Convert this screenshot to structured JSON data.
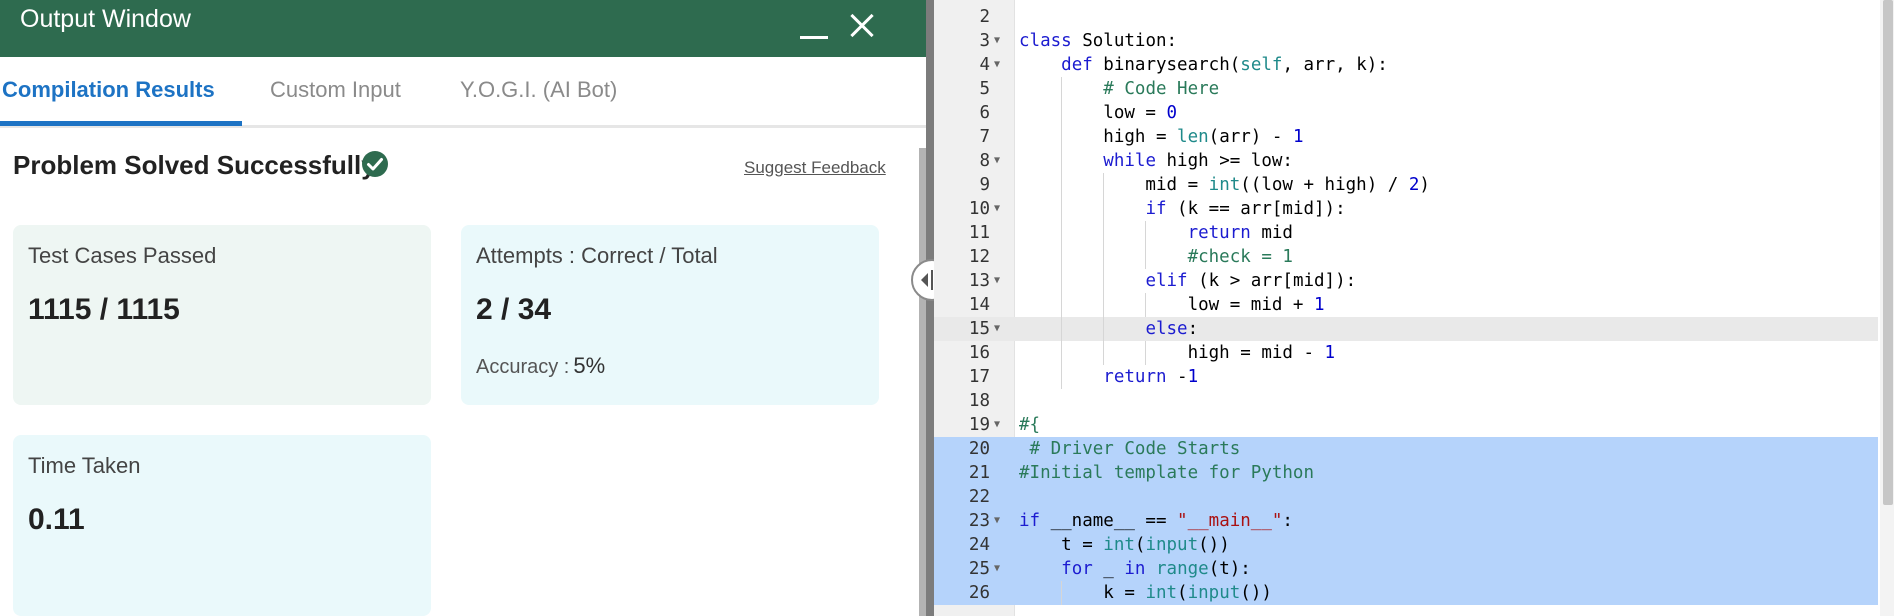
{
  "output_window": {
    "title": "Output Window",
    "tabs": [
      "Compilation Results",
      "Custom Input",
      "Y.O.G.I. (AI Bot)"
    ],
    "status_title": "Problem Solved Successfully",
    "suggest_feedback": "Suggest Feedback",
    "cards": {
      "tests_label": "Test Cases Passed",
      "tests_value": "1115 / 1115",
      "attempts_label": "Attempts : Correct / Total",
      "attempts_value": "2 / 34",
      "accuracy_label": "Accuracy :",
      "accuracy_value": "5%",
      "time_label": "Time Taken",
      "time_value": "0.11"
    }
  },
  "editor": {
    "active_line": 15,
    "selected_lines": [
      20,
      21,
      22,
      23,
      24,
      25,
      26
    ],
    "lines": [
      {
        "n": "2",
        "text": ""
      },
      {
        "n": "3",
        "text": "class Solution:"
      },
      {
        "n": "4",
        "text": "    def binarysearch(self, arr, k):"
      },
      {
        "n": "5",
        "text": "        # Code Here"
      },
      {
        "n": "6",
        "text": "        low = 0"
      },
      {
        "n": "7",
        "text": "        high = len(arr) - 1"
      },
      {
        "n": "8",
        "text": "        while high >= low:"
      },
      {
        "n": "9",
        "text": "            mid = int((low + high) / 2)"
      },
      {
        "n": "10",
        "text": "            if (k == arr[mid]):"
      },
      {
        "n": "11",
        "text": "                return mid"
      },
      {
        "n": "12",
        "text": "                #check = 1"
      },
      {
        "n": "13",
        "text": "            elif (k > arr[mid]):"
      },
      {
        "n": "14",
        "text": "                low = mid + 1"
      },
      {
        "n": "15",
        "text": "            else:"
      },
      {
        "n": "16",
        "text": "                high = mid - 1"
      },
      {
        "n": "17",
        "text": "        return -1"
      },
      {
        "n": "18",
        "text": ""
      },
      {
        "n": "19",
        "text": "#{"
      },
      {
        "n": "20",
        "text": " # Driver Code Starts"
      },
      {
        "n": "21",
        "text": "#Initial template for Python"
      },
      {
        "n": "22",
        "text": ""
      },
      {
        "n": "23",
        "text": "if __name__ == \"__main__\":"
      },
      {
        "n": "24",
        "text": "    t = int(input())"
      },
      {
        "n": "25",
        "text": "    for _ in range(t):"
      },
      {
        "n": "26",
        "text": "        k = int(input())"
      }
    ]
  },
  "colors": {
    "header": "#2e6b4f",
    "accent": "#1d73c4",
    "selection": "#b5d3fb"
  }
}
